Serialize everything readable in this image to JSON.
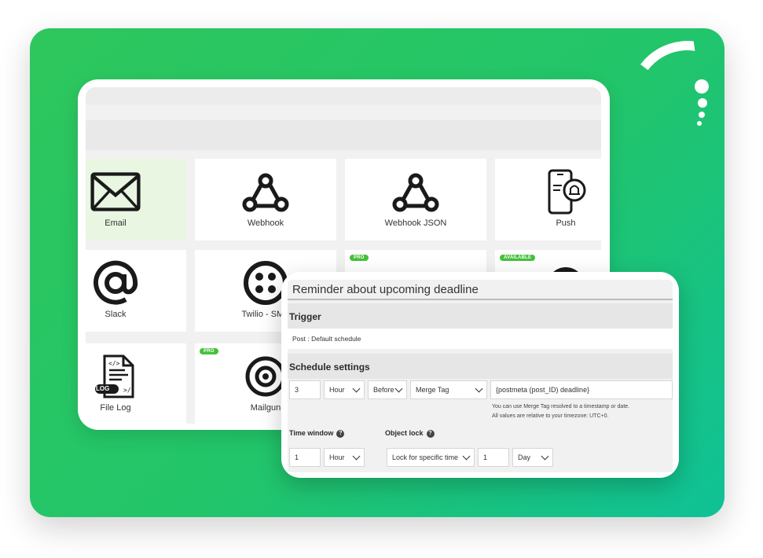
{
  "channels": [
    {
      "label": "Email",
      "icon": "envelope-icon",
      "selected": true
    },
    {
      "label": "Webhook",
      "icon": "webhook-icon"
    },
    {
      "label": "Webhook JSON",
      "icon": "webhook-icon"
    },
    {
      "label": "Push",
      "icon": "phone-bell-icon"
    },
    {
      "label": "Slack",
      "icon": "at-sign-icon"
    },
    {
      "label": "Twilio - SMS",
      "icon": "twilio-icon"
    },
    {
      "label": "",
      "icon": "discord-icon",
      "badge": "PRO"
    },
    {
      "label": "",
      "icon": "avatar-icon",
      "badge": "AVAILABLE"
    },
    {
      "label": "File Log",
      "icon": "file-log-icon"
    },
    {
      "label": "Mailgun",
      "icon": "mailgun-icon",
      "badge": "PRO"
    }
  ],
  "log_tag": "LOG",
  "overlay": {
    "title": "Reminder about upcoming deadline",
    "trigger_heading": "Trigger",
    "trigger_value": "Post : Default schedule",
    "schedule_heading": "Schedule settings",
    "schedule_amount": "3",
    "schedule_unit": "Hour",
    "schedule_relation": "Before",
    "schedule_source": "Merge Tag",
    "schedule_tag": "{postmeta (post_ID) deadline}",
    "note_1": "You can use Merge Tag resolved to a timestamp or date.",
    "note_2": "All values are relative to your timezone: UTC+0.",
    "time_window_label": "Time window",
    "object_lock_label": "Object lock",
    "time_window_amount": "1",
    "time_window_unit": "Hour",
    "object_lock_mode": "Lock for specific time",
    "object_lock_amount": "1",
    "object_lock_unit": "Day"
  },
  "colors": {
    "accent": "#22c56a",
    "badge": "#46c03c",
    "selected_tile": "#e8f6e2"
  }
}
